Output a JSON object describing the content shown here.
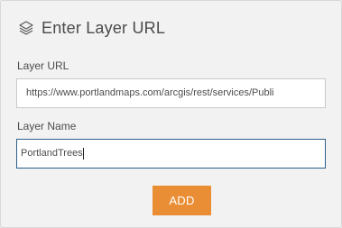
{
  "header": {
    "title": "Enter Layer URL",
    "icon": "layers-icon"
  },
  "layer_url": {
    "label": "Layer URL",
    "value": "https://www.portlandmaps.com/arcgis/rest/services/Publi"
  },
  "layer_name": {
    "label": "Layer Name",
    "value": "PortlandTrees"
  },
  "add_button": {
    "label": "ADD",
    "color": "#e98e35"
  }
}
